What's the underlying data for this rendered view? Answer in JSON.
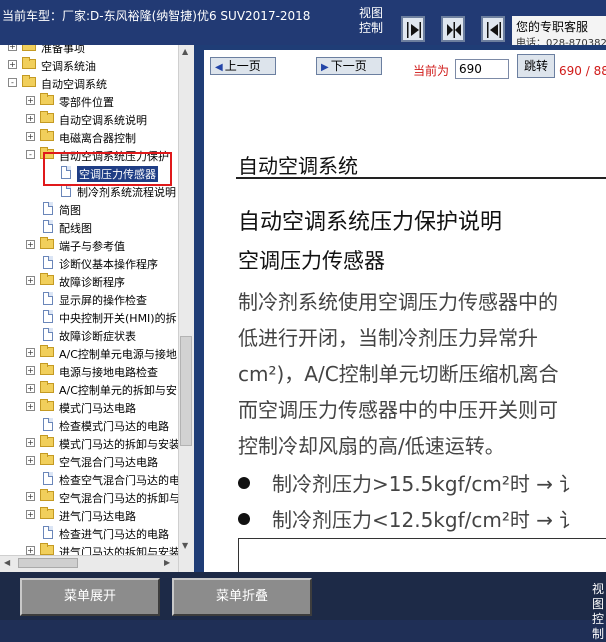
{
  "header": {
    "title": "当前车型：厂家:D-东风裕隆(纳智捷)优6 SUV2017-2018",
    "view_control": "视图控制",
    "support_title": "您的专职客服",
    "support_phone": "电话：028-8703829"
  },
  "tree": {
    "items": [
      {
        "label": "准备事项",
        "type": "folder",
        "expander": "+"
      },
      {
        "label": "空调系统油",
        "type": "folder",
        "expander": "+"
      },
      {
        "label": "自动空调系统",
        "type": "folder",
        "expander": "-"
      },
      {
        "label": "零部件位置",
        "type": "folder",
        "expander": "+"
      },
      {
        "label": "自动空调系统说明",
        "type": "folder",
        "expander": "+"
      },
      {
        "label": "电磁离合器控制",
        "type": "folder",
        "expander": "+"
      },
      {
        "label": "自动空调系统压力保护",
        "type": "folder",
        "expander": "-"
      },
      {
        "label": "空调压力传感器",
        "type": "doc",
        "selected": true
      },
      {
        "label": "制冷剂系统流程说明",
        "type": "doc"
      },
      {
        "label": "简图",
        "type": "doc"
      },
      {
        "label": "配线图",
        "type": "doc"
      },
      {
        "label": "端子与参考值",
        "type": "folder",
        "expander": "+"
      },
      {
        "label": "诊断仪基本操作程序",
        "type": "doc"
      },
      {
        "label": "故障诊断程序",
        "type": "folder",
        "expander": "+"
      },
      {
        "label": "显示屏的操作检查",
        "type": "doc"
      },
      {
        "label": "中央控制开关(HMI)的拆",
        "type": "doc"
      },
      {
        "label": "故障诊断症状表",
        "type": "doc"
      },
      {
        "label": "A/C控制单元电源与接地",
        "type": "folder",
        "expander": "+"
      },
      {
        "label": "电源与接地电路检查",
        "type": "folder",
        "expander": "+"
      },
      {
        "label": "A/C控制单元的拆卸与安",
        "type": "folder",
        "expander": "+"
      },
      {
        "label": "模式门马达电路",
        "type": "folder",
        "expander": "+"
      },
      {
        "label": "检查模式门马达的电路",
        "type": "doc"
      },
      {
        "label": "模式门马达的拆卸与安装",
        "type": "folder",
        "expander": "+"
      },
      {
        "label": "空气混合门马达电路",
        "type": "folder",
        "expander": "+"
      },
      {
        "label": "检查空气混合门马达的电",
        "type": "doc"
      },
      {
        "label": "空气混合门马达的拆卸与",
        "type": "folder",
        "expander": "+"
      },
      {
        "label": "进气门马达电路",
        "type": "folder",
        "expander": "+"
      },
      {
        "label": "检查进气门马达的电路",
        "type": "doc"
      },
      {
        "label": "进气门马达的拆卸与安装",
        "type": "folder",
        "expander": "+"
      }
    ]
  },
  "viewer": {
    "prev_label": "上一页",
    "next_label": "下一页",
    "current_label": "当前为",
    "current_page": "690",
    "jump_label": "跳转",
    "page_count": "690 / 88"
  },
  "document": {
    "section_title": "自动空调系统",
    "heading": "自动空调系统压力保护说明",
    "subheading": "空调压力传感器",
    "lines": [
      "制冷剂系统使用空调压力传感器中的",
      "低进行开闭，当制冷剂压力异常升",
      "cm²)，A/C控制单元切断压缩机离合",
      "而空调压力传感器中的中压开关则可",
      "控制冷却风扇的高/低速运转。"
    ],
    "bullets": [
      "制冷剂压力>15.5kgf/cm²时 → 讠",
      "制冷剂压力<12.5kgf/cm²时 → 讠"
    ]
  },
  "bottom": {
    "expand_label": "菜单展开",
    "collapse_label": "菜单折叠",
    "view_control": "视图控制"
  },
  "colors": {
    "header_bg": "#223a74",
    "accent_red": "#d01a18",
    "selection_bg": "#1f3e86",
    "highlight_box": "#e0191b"
  }
}
